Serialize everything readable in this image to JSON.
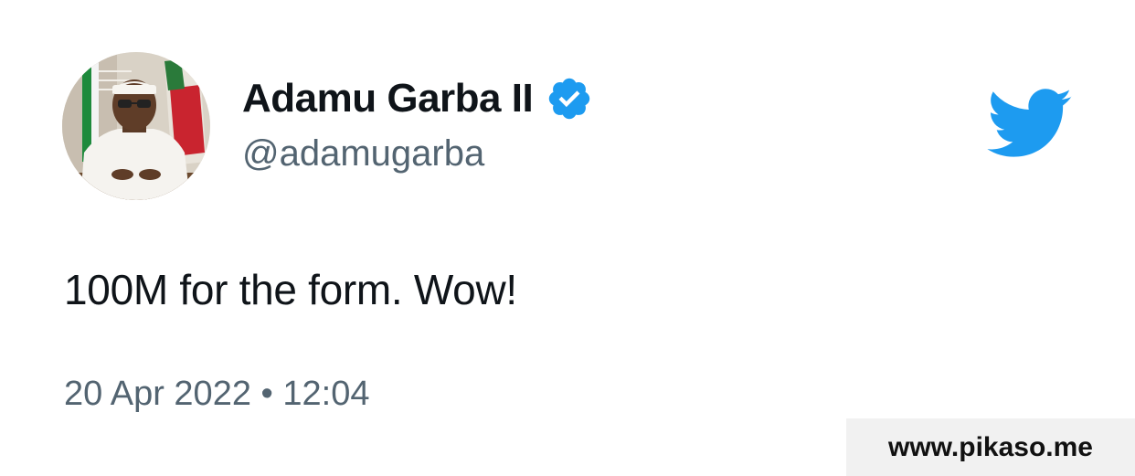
{
  "tweet": {
    "author": {
      "display_name": "Adamu Garba II",
      "handle": "@adamugarba",
      "verified": true,
      "avatar_icon": "profile-photo"
    },
    "text": "100M for the form. Wow!",
    "timestamp": "20 Apr 2022 • 12:04"
  },
  "brand": {
    "logo_icon": "twitter-bird-icon",
    "color": "#1d9bf0"
  },
  "watermark": {
    "text": "www.pikaso.me"
  },
  "colors": {
    "primary_text": "#0f1419",
    "secondary_text": "#536471",
    "verified_badge": "#1d9bf0"
  }
}
